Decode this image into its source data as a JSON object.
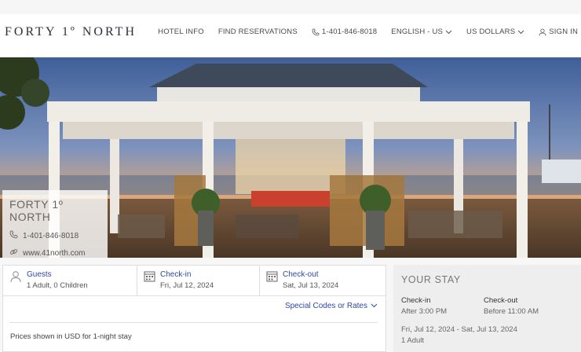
{
  "header": {
    "logo": "FORTY 1º NORTH",
    "nav": [
      {
        "label": "HOTEL INFO"
      },
      {
        "label": "FIND RESERVATIONS"
      },
      {
        "label": "1-401-846-8018",
        "icon": "phone-icon"
      },
      {
        "label": "ENGLISH - US",
        "icon": "chevron-down-icon"
      },
      {
        "label": "US DOLLARS",
        "icon": "chevron-down-icon"
      },
      {
        "label": "SIGN IN",
        "icon": "user-icon"
      }
    ]
  },
  "hotel": {
    "name": "FORTY 1º NORTH",
    "phone": "1-401-846-8018",
    "website": "www.41north.com"
  },
  "search": {
    "guests": {
      "label": "Guests",
      "value": "1 Adult, 0 Children"
    },
    "checkin": {
      "label": "Check-in",
      "value": "Fri, Jul 12, 2024"
    },
    "checkout": {
      "label": "Check-out",
      "value": "Sat, Jul 13, 2024"
    },
    "special_codes": "Special Codes or Rates",
    "prices_note": "Prices shown in USD for 1-night stay"
  },
  "your_stay": {
    "title": "YOUR STAY",
    "checkin_label": "Check-in",
    "checkin_value": "After 3:00 PM",
    "checkout_label": "Check-out",
    "checkout_value": "Before 11:00 AM",
    "dates": "Fri, Jul 12, 2024 - Sat, Jul 13, 2024",
    "guests": "1 Adult"
  },
  "colors": {
    "link": "#2f4aa0",
    "logo": "#2b2f3a"
  }
}
